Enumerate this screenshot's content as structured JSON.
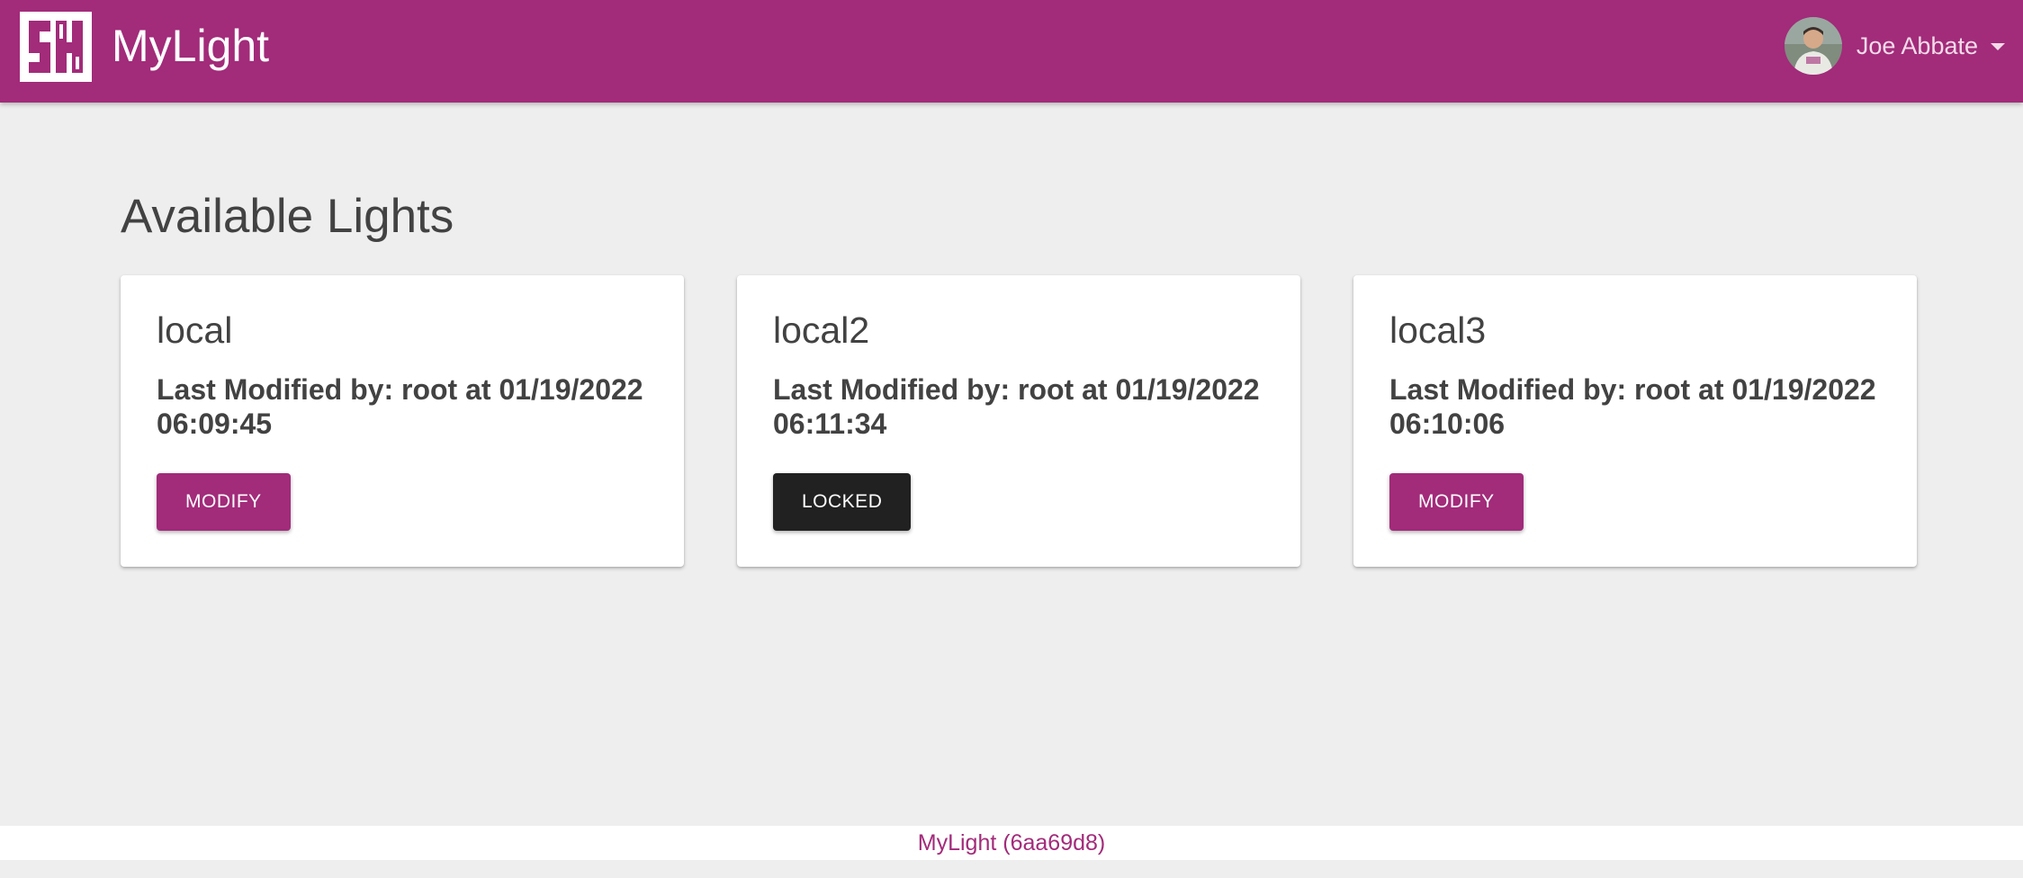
{
  "header": {
    "brand": "MyLight",
    "logo_icon": "sh-logo-icon",
    "user_name": "Joe Abbate",
    "avatar_icon": "user-avatar",
    "accent_color": "#a22b7a"
  },
  "main": {
    "title": "Available Lights",
    "lights": [
      {
        "name": "local",
        "modified": "Last Modified by: root at 01/19/2022 06:09:45",
        "button": "MODIFY",
        "state": "modify"
      },
      {
        "name": "local2",
        "modified": "Last Modified by: root at 01/19/2022 06:11:34",
        "button": "LOCKED",
        "state": "locked"
      },
      {
        "name": "local3",
        "modified": "Last Modified by: root at 01/19/2022 06:10:06",
        "button": "MODIFY",
        "state": "modify"
      }
    ]
  },
  "footer": {
    "text": "MyLight (6aa69d8)"
  }
}
